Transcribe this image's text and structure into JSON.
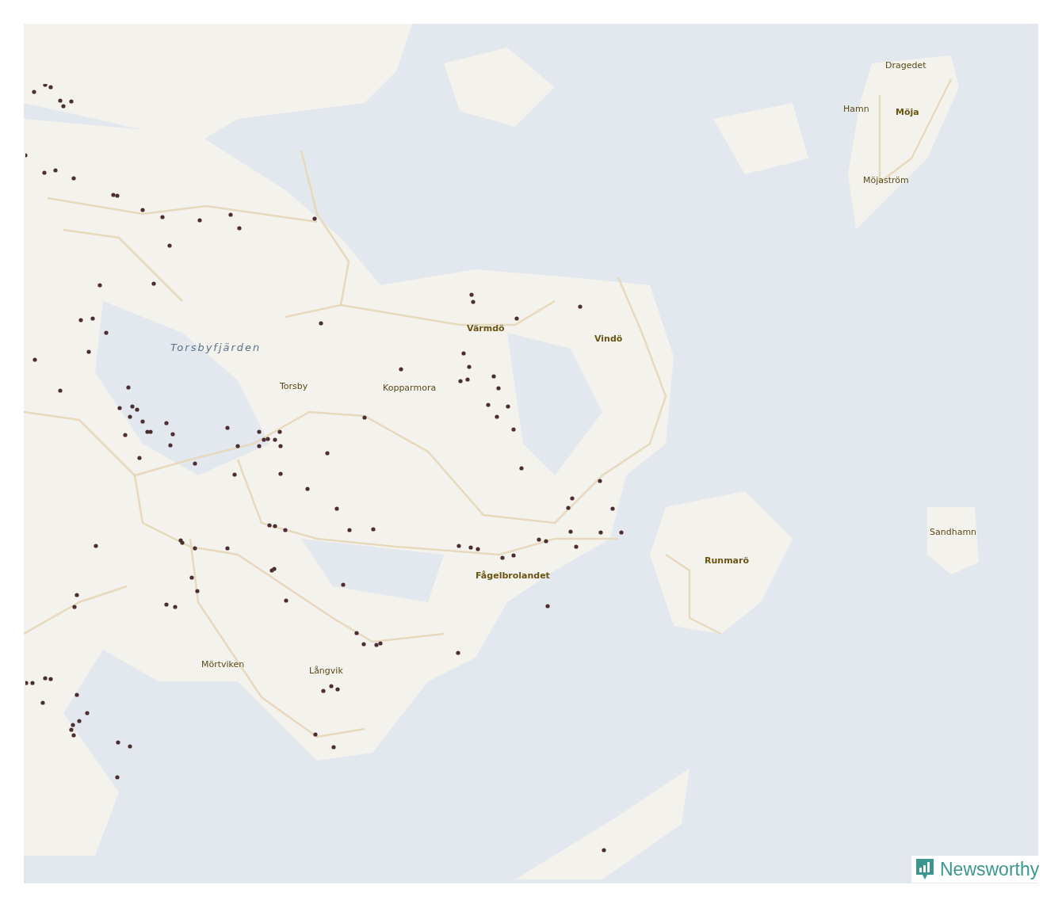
{
  "map": {
    "labels": [
      {
        "text": "Dragedet",
        "kind": "locality"
      },
      {
        "text": "Hamn",
        "kind": "locality"
      },
      {
        "text": "Möja",
        "kind": "island"
      },
      {
        "text": "Möjaström",
        "kind": "locality"
      },
      {
        "text": "Torsbyfjärden",
        "kind": "water"
      },
      {
        "text": "Värmdö",
        "kind": "island"
      },
      {
        "text": "Vindö",
        "kind": "island"
      },
      {
        "text": "Torsby",
        "kind": "locality"
      },
      {
        "text": "Kopparmora",
        "kind": "locality"
      },
      {
        "text": "Sandhamn",
        "kind": "locality"
      },
      {
        "text": "Runmarö",
        "kind": "island"
      },
      {
        "text": "Fågelbrolandet",
        "kind": "island"
      },
      {
        "text": "Mörtviken",
        "kind": "locality"
      },
      {
        "text": "Långvik",
        "kind": "locality"
      }
    ]
  },
  "brand": {
    "name": "Newsworthy"
  }
}
